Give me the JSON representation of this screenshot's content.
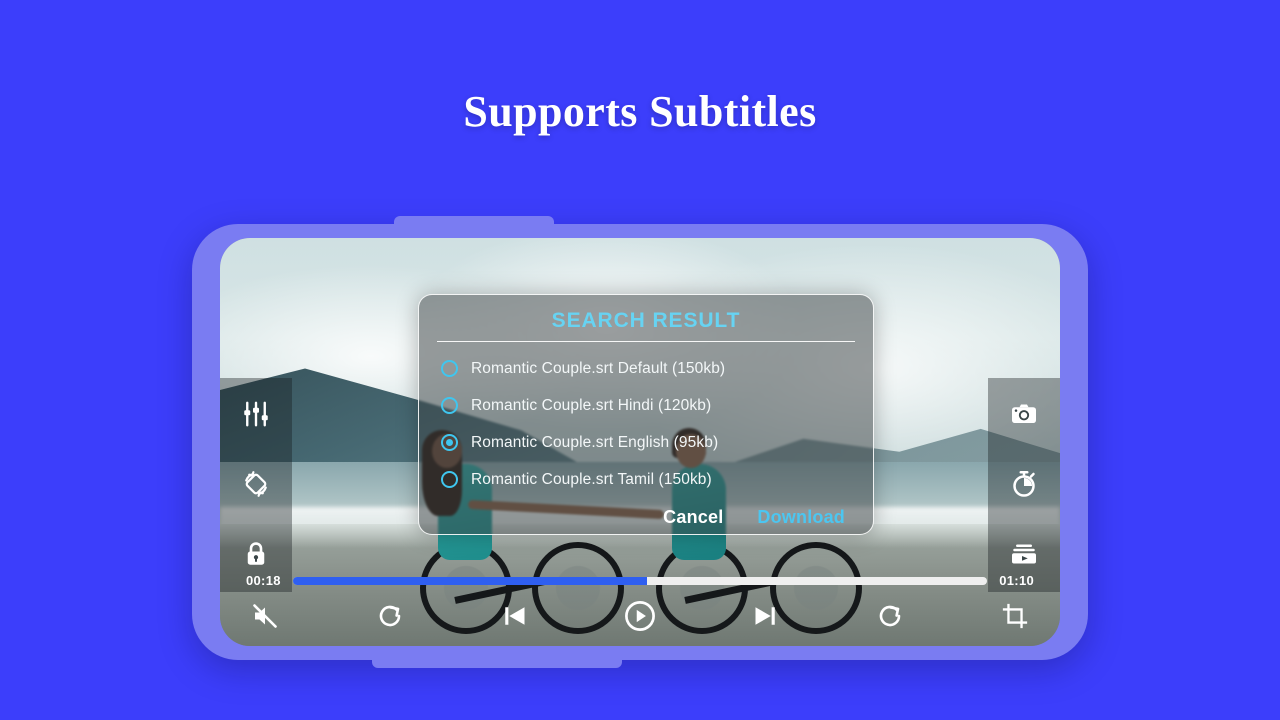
{
  "headline": "Supports Subtitles",
  "theme": {
    "background": "#3c3efb",
    "phone_frame": "#7a7cf2",
    "accent_cyan": "#4cc6f0",
    "progress_fill": "#2f5ff0",
    "progress_track": "#efefef"
  },
  "side_left": {
    "items": [
      {
        "name": "equalizer-icon",
        "label": "Equalizer"
      },
      {
        "name": "screen-rotate-icon",
        "label": "Rotate screen"
      },
      {
        "name": "lock-icon",
        "label": "Lock"
      }
    ]
  },
  "side_right": {
    "items": [
      {
        "name": "camera-icon",
        "label": "Screenshot"
      },
      {
        "name": "stopwatch-icon",
        "label": "Sleep timer"
      },
      {
        "name": "video-list-icon",
        "label": "Playlist"
      }
    ]
  },
  "dialog": {
    "title": "SEARCH RESULT",
    "options": [
      {
        "label": "Romantic Couple.srt Default (150kb)",
        "selected": false
      },
      {
        "label": "Romantic Couple.srt Hindi (120kb)",
        "selected": false
      },
      {
        "label": "Romantic Couple.srt English (95kb)",
        "selected": true
      },
      {
        "label": "Romantic Couple.srt Tamil (150kb)",
        "selected": false
      }
    ],
    "cancel_label": "Cancel",
    "download_label": "Download"
  },
  "player": {
    "current_time": "00:18",
    "total_time": "01:10",
    "progress_percent": 51,
    "controls": [
      {
        "name": "mute-button",
        "label": "Mute"
      },
      {
        "name": "replay-button",
        "label": "Replay"
      },
      {
        "name": "previous-button",
        "label": "Previous"
      },
      {
        "name": "play-button",
        "label": "Play"
      },
      {
        "name": "next-button",
        "label": "Next"
      },
      {
        "name": "repeat-button",
        "label": "Repeat"
      },
      {
        "name": "crop-button",
        "label": "Crop"
      }
    ]
  }
}
